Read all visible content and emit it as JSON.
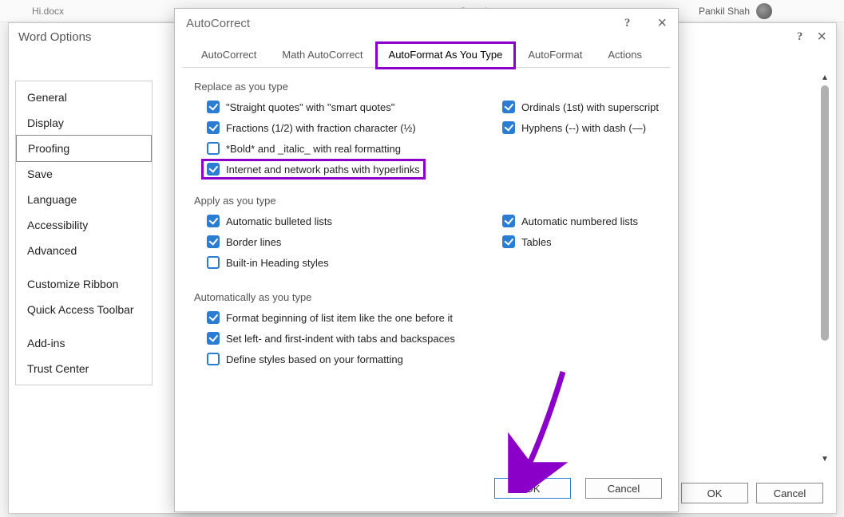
{
  "background": {
    "filename": "Hi.docx",
    "search": "Search",
    "user": "Pankil Shah"
  },
  "word_options": {
    "title": "Word Options",
    "sidebar": {
      "items": [
        {
          "label": "General"
        },
        {
          "label": "Display"
        },
        {
          "label": "Proofing",
          "selected": true
        },
        {
          "label": "Save"
        },
        {
          "label": "Language"
        },
        {
          "label": "Accessibility"
        },
        {
          "label": "Advanced"
        },
        {
          "label": "Customize Ribbon",
          "gap": true
        },
        {
          "label": "Quick Access Toolbar"
        },
        {
          "label": "Add-ins",
          "gap": true
        },
        {
          "label": "Trust Center"
        }
      ]
    },
    "buttons": {
      "ok": "OK",
      "cancel": "Cancel"
    }
  },
  "autocorrect": {
    "title": "AutoCorrect",
    "tabs": [
      {
        "label": "AutoCorrect"
      },
      {
        "label": "Math AutoCorrect"
      },
      {
        "label": "AutoFormat As You Type",
        "active": true,
        "highlighted": true
      },
      {
        "label": "AutoFormat"
      },
      {
        "label": "Actions"
      }
    ],
    "section1": {
      "heading": "Replace as you type",
      "options": [
        {
          "label": "\"Straight quotes\" with \"smart quotes\"",
          "checked": true
        },
        {
          "label": "Ordinals (1st) with superscript",
          "checked": true
        },
        {
          "label": "Fractions (1/2) with fraction character (½)",
          "checked": true
        },
        {
          "label": "Hyphens (--) with dash (—)",
          "checked": true
        },
        {
          "label": "*Bold* and _italic_ with real formatting",
          "checked": false
        },
        {
          "label": "Internet and network paths with hyperlinks",
          "checked": true,
          "highlighted": true
        }
      ]
    },
    "section2": {
      "heading": "Apply as you type",
      "options": [
        {
          "label": "Automatic bulleted lists",
          "checked": true
        },
        {
          "label": "Automatic numbered lists",
          "checked": true
        },
        {
          "label": "Border lines",
          "checked": true
        },
        {
          "label": "Tables",
          "checked": true
        },
        {
          "label": "Built-in Heading styles",
          "checked": false
        }
      ]
    },
    "section3": {
      "heading": "Automatically as you type",
      "options": [
        {
          "label": "Format beginning of list item like the one before it",
          "checked": true
        },
        {
          "label": "Set left- and first-indent with tabs and backspaces",
          "checked": true
        },
        {
          "label": "Define styles based on your formatting",
          "checked": false
        }
      ]
    },
    "buttons": {
      "ok": "OK",
      "cancel": "Cancel"
    }
  },
  "annotation": {
    "highlight_color": "#8a00c9"
  }
}
